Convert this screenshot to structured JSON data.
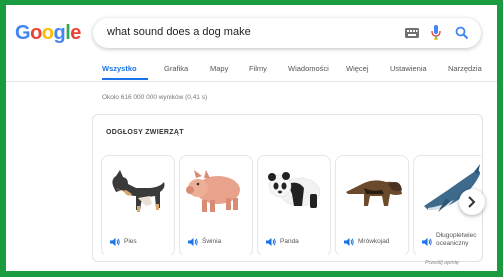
{
  "colors": {
    "frame": "#1a9b3f",
    "accent": "#1a73e8",
    "logo": [
      "#4285f4",
      "#ea4335",
      "#fbbc05",
      "#4285f4",
      "#34a853",
      "#ea4335"
    ]
  },
  "logo": {
    "letters": [
      "G",
      "o",
      "o",
      "g",
      "l",
      "e"
    ]
  },
  "search": {
    "query": "what sound does a dog make",
    "icons": [
      "keyboard-icon",
      "mic-icon",
      "search-icon"
    ]
  },
  "tabs": [
    {
      "label": "Wszystko",
      "active": true
    },
    {
      "label": "Grafika",
      "active": false
    },
    {
      "label": "Mapy",
      "active": false
    },
    {
      "label": "Filmy",
      "active": false
    },
    {
      "label": "Wiadomości",
      "active": false
    },
    {
      "label": "Więcej",
      "active": false
    },
    {
      "label": "Ustawienia",
      "active": false
    },
    {
      "label": "Narzędzia",
      "active": false
    }
  ],
  "results_stats": "Około 616 000 000 wyników (0,41 s)",
  "card": {
    "title": "ODGŁOSY ZWIERZĄT",
    "animals": [
      {
        "label": "Pies",
        "icon": "dog-icon"
      },
      {
        "label": "Świnia",
        "icon": "pig-icon"
      },
      {
        "label": "Panda",
        "icon": "panda-icon"
      },
      {
        "label": "Mrówkojad",
        "icon": "anteater-icon"
      },
      {
        "label": "Długopletwiec oceaniczny",
        "icon": "whale-icon"
      }
    ],
    "next_icon": "chevron-right-icon"
  },
  "feedback": "Prześlij opinię"
}
